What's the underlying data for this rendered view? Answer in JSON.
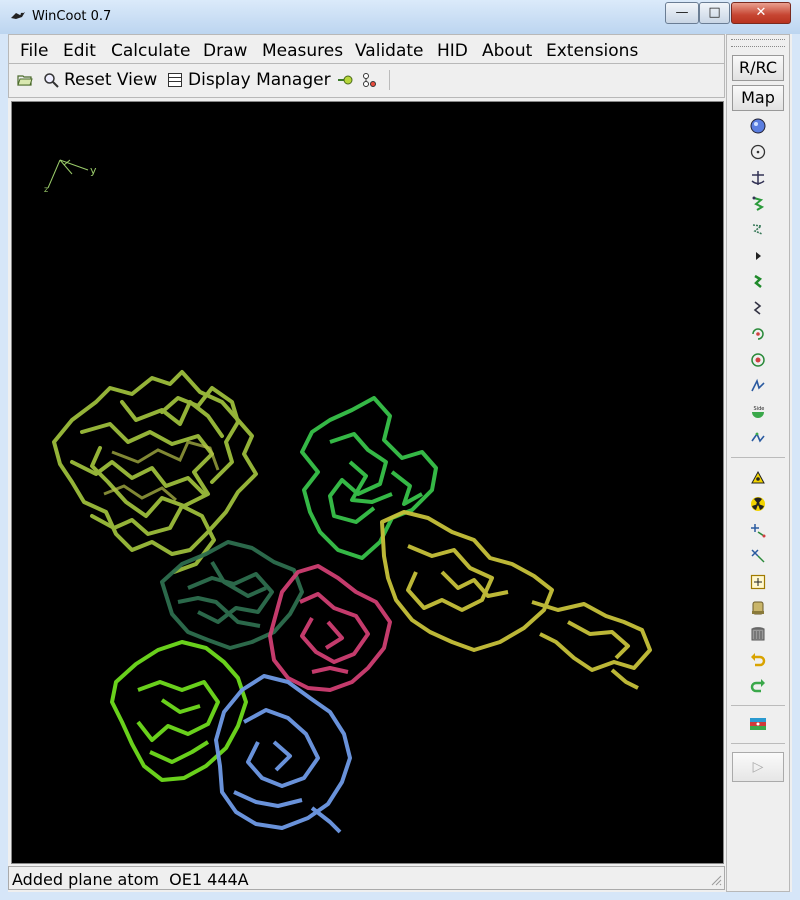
{
  "window": {
    "title": "WinCoot 0.7"
  },
  "menubar": {
    "items": [
      "File",
      "Edit",
      "Calculate",
      "Draw",
      "Measures",
      "Validate",
      "HID",
      "About",
      "Extensions"
    ]
  },
  "toolbar": {
    "reset_view_label": "Reset View",
    "display_manager_label": "Display Manager"
  },
  "sidebar": {
    "rrc_label": "R/RC",
    "map_label": "Map"
  },
  "viewport": {
    "axes_label": "y",
    "background": "#000000"
  },
  "status": {
    "text": "Added plane atom  OE1 444A"
  },
  "colors": {
    "chain_yellowgreen": "#9cbd3c",
    "chain_green": "#38c24a",
    "chain_darkgreen": "#2e6e4e",
    "chain_pink": "#cf3f72",
    "chain_lime": "#6fdc1e",
    "chain_blue": "#6f9ae6",
    "chain_yellow": "#c7c13a"
  }
}
